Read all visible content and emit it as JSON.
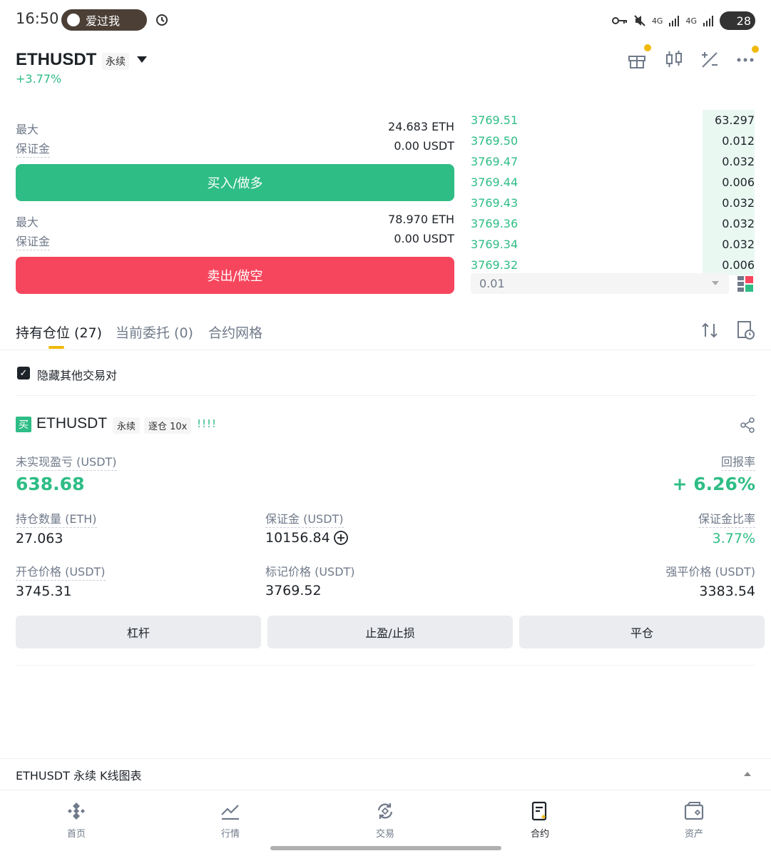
{
  "status_bar": {
    "time": "16:50",
    "notification": "爱过我",
    "network1": "4G",
    "network2": "4G",
    "battery": "28"
  },
  "header": {
    "symbol": "ETHUSDT",
    "contract_type": "永续",
    "change_pct": "+3.77%"
  },
  "order_form": {
    "buy": {
      "max_label": "最大",
      "max_value": "24.683 ETH",
      "margin_label": "保证金",
      "margin_value": "0.00 USDT",
      "button": "买入/做多"
    },
    "sell": {
      "max_label": "最大",
      "max_value": "78.970 ETH",
      "margin_label": "保证金",
      "margin_value": "0.00 USDT",
      "button": "卖出/做空"
    }
  },
  "order_book": {
    "rows": [
      {
        "price": "3769.51",
        "qty": "63.297"
      },
      {
        "price": "3769.50",
        "qty": "0.012"
      },
      {
        "price": "3769.47",
        "qty": "0.032"
      },
      {
        "price": "3769.44",
        "qty": "0.006"
      },
      {
        "price": "3769.43",
        "qty": "0.032"
      },
      {
        "price": "3769.36",
        "qty": "0.032"
      },
      {
        "price": "3769.34",
        "qty": "0.032"
      },
      {
        "price": "3769.32",
        "qty": "0.006"
      }
    ],
    "precision": "0.01"
  },
  "tabs": {
    "positions": "持有仓位 (27)",
    "open_orders": "当前委托 (0)",
    "grid": "合约网格"
  },
  "filter": {
    "hide_other_pairs": "隐藏其他交易对"
  },
  "position": {
    "side": "买",
    "symbol": "ETHUSDT",
    "type": "永续",
    "margin_mode": "逐仓 10x",
    "signal": "!!!!",
    "unrealized_pnl_label": "未实现盈亏 (USDT)",
    "unrealized_pnl": "638.68",
    "roe_label": "回报率",
    "roe": "+ 6.26%",
    "size_label": "持仓数量 (ETH)",
    "size": "27.063",
    "margin_label": "保证金 (USDT)",
    "margin": "10156.84",
    "margin_ratio_label": "保证金比率",
    "margin_ratio": "3.77%",
    "entry_label": "开仓价格 (USDT)",
    "entry": "3745.31",
    "mark_label": "标记价格 (USDT)",
    "mark": "3769.52",
    "liq_label": "强平价格 (USDT)",
    "liq": "3383.54",
    "actions": {
      "leverage": "杠杆",
      "tpsl": "止盈/止损",
      "close": "平仓"
    }
  },
  "kline_bar": {
    "label": "ETHUSDT 永续 K线图表"
  },
  "bottom_nav": [
    {
      "label": "首页",
      "icon": "home-icon"
    },
    {
      "label": "行情",
      "icon": "markets-icon"
    },
    {
      "label": "交易",
      "icon": "trade-icon"
    },
    {
      "label": "合约",
      "icon": "futures-icon"
    },
    {
      "label": "资产",
      "icon": "wallet-icon"
    }
  ],
  "colors": {
    "green": "#2ebd85",
    "red": "#f6465d",
    "accent": "#f0b90b"
  }
}
